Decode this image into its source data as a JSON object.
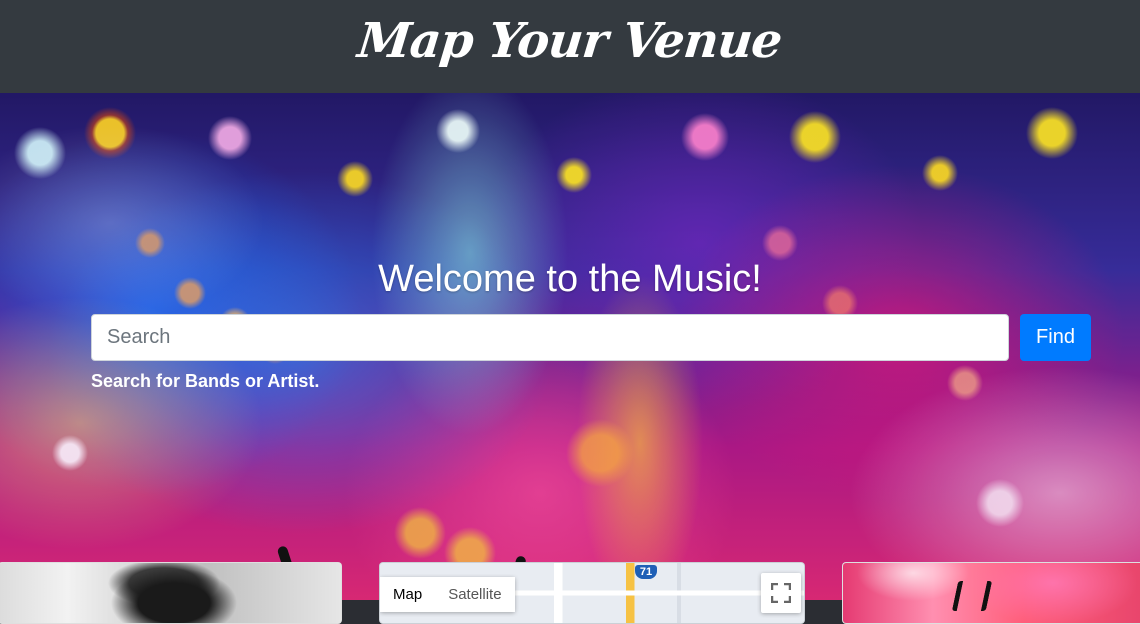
{
  "navbar": {
    "brand": "Map Your Venue"
  },
  "hero": {
    "title": "Welcome to the Music!",
    "search": {
      "placeholder": "Search",
      "value": ""
    },
    "find_button": "Find",
    "help_text": "Search for Bands or Artist."
  },
  "cards": {
    "map": {
      "tabs": [
        "Map",
        "Satellite"
      ],
      "highway_label": "71"
    }
  },
  "colors": {
    "navbar_bg": "#343a40",
    "accent": "#007bff"
  },
  "icons": {
    "fullscreen": "fullscreen-icon"
  }
}
